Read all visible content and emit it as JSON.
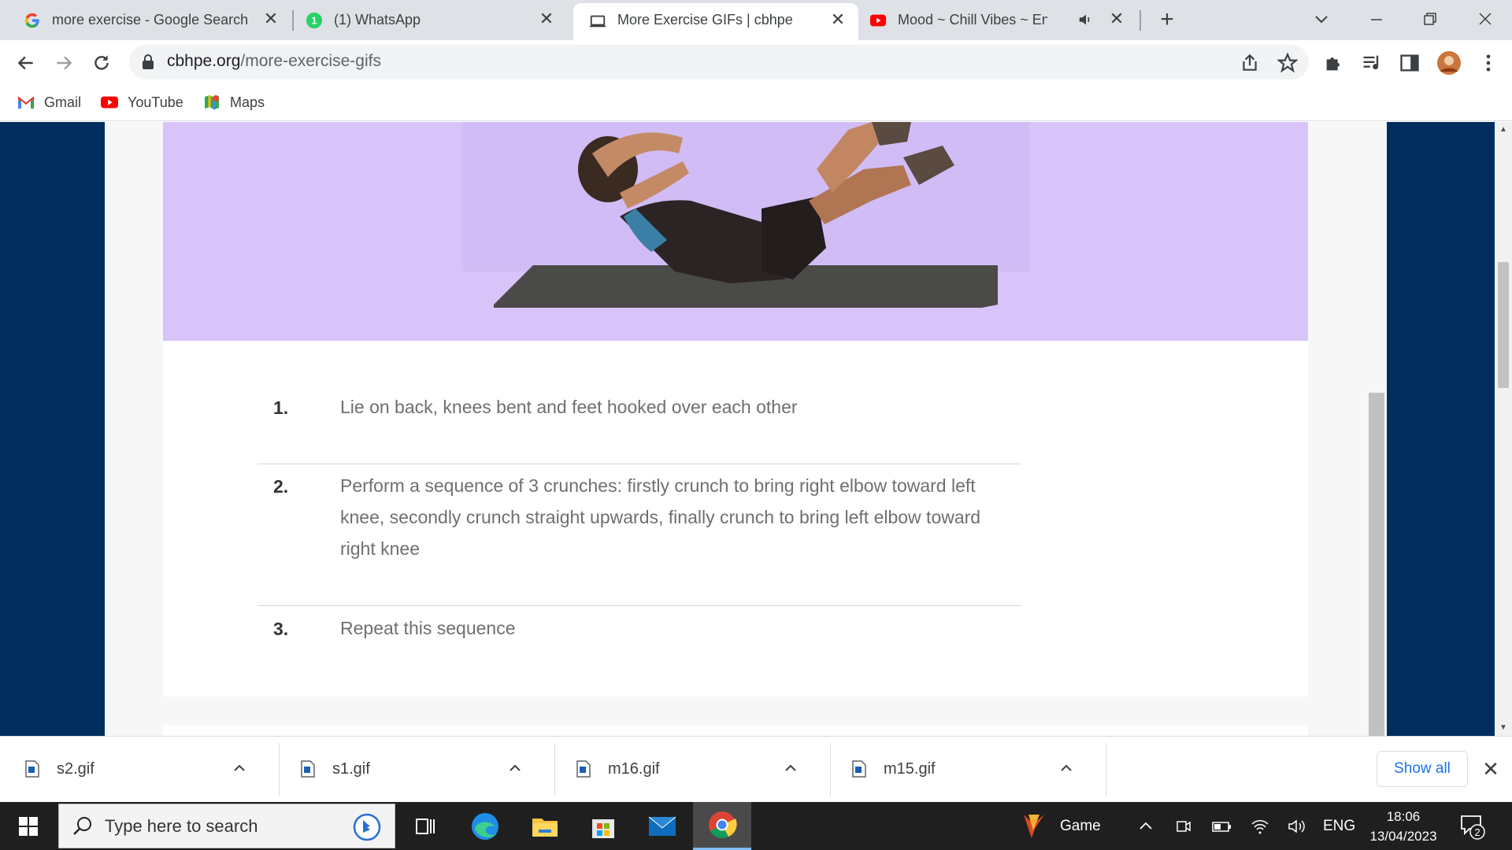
{
  "browser": {
    "tabs": [
      {
        "title": "more exercise - Google Search",
        "favicon": "google-g-icon",
        "active": false
      },
      {
        "title": "(1) WhatsApp",
        "favicon": "whatsapp-icon",
        "badge": "1",
        "active": false
      },
      {
        "title": "More Exercise GIFs | cbhpe",
        "favicon": "laptop-icon",
        "active": true
      },
      {
        "title": "Mood ~ Chill Vibes ~ English",
        "favicon": "youtube-icon",
        "active": false,
        "audio": true
      }
    ],
    "url_domain": "cbhpe.org",
    "url_path": "/more-exercise-gifs",
    "bookmarks": [
      {
        "label": "Gmail",
        "icon": "gmail-icon"
      },
      {
        "label": "YouTube",
        "icon": "youtube-icon"
      },
      {
        "label": "Maps",
        "icon": "maps-icon"
      }
    ]
  },
  "page": {
    "steps": [
      {
        "number": "1.",
        "text": "Lie on back, knees bent and feet hooked over each other"
      },
      {
        "number": "2.",
        "text": "Perform a sequence of 3 crunches: firstly crunch to bring right elbow toward left knee, secondly crunch straight upwards, finally crunch to bring left elbow toward right knee"
      },
      {
        "number": "3.",
        "text": "Repeat this sequence"
      }
    ]
  },
  "downloads": {
    "items": [
      {
        "name": "s2.gif"
      },
      {
        "name": "s1.gif"
      },
      {
        "name": "m16.gif"
      },
      {
        "name": "m15.gif"
      }
    ],
    "show_all_label": "Show all"
  },
  "taskbar": {
    "search_placeholder": "Type here to search",
    "game_label": "Game",
    "language": "ENG",
    "time": "18:06",
    "date": "13/04/2023",
    "notification_count": "2"
  },
  "colors": {
    "site_background": "#012e5e",
    "gif_background": "#d8c4f8",
    "link_blue": "#1a73e8"
  }
}
